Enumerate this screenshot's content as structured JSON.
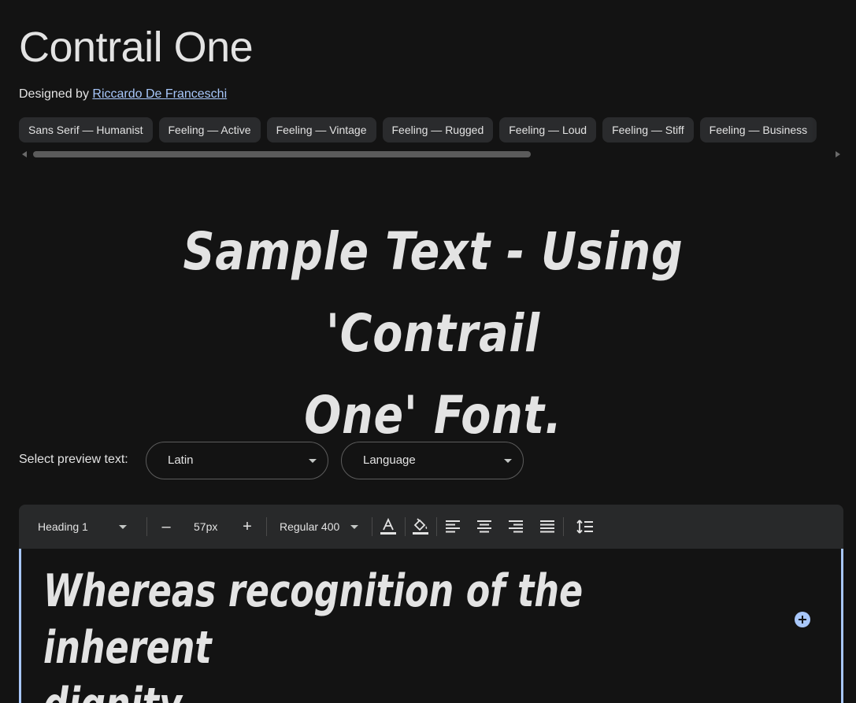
{
  "font": {
    "title": "Contrail One",
    "designed_by_label": "Designed by",
    "designer": "Riccardo De Franceschi"
  },
  "tags": [
    "Sans Serif — Humanist",
    "Feeling — Active",
    "Feeling — Vintage",
    "Feeling — Rugged",
    "Feeling — Loud",
    "Feeling — Stiff",
    "Feeling — Business"
  ],
  "hero": {
    "line1": "Sample Text - Using 'Contrail",
    "line2": "One' Font."
  },
  "preview": {
    "label": "Select preview text:",
    "script_select": "Latin",
    "language_select": "Language"
  },
  "toolbar": {
    "style": "Heading 1",
    "size": "57px",
    "weight": "Regular 400",
    "minus": "–",
    "plus": "+"
  },
  "editor": {
    "line1": "Whereas recognition of the inherent",
    "line2": "dignity"
  },
  "colors": {
    "background": "#131313",
    "accent": "#a8c7fa",
    "chip": "#2a2b2d",
    "toolbar": "#28292a"
  }
}
